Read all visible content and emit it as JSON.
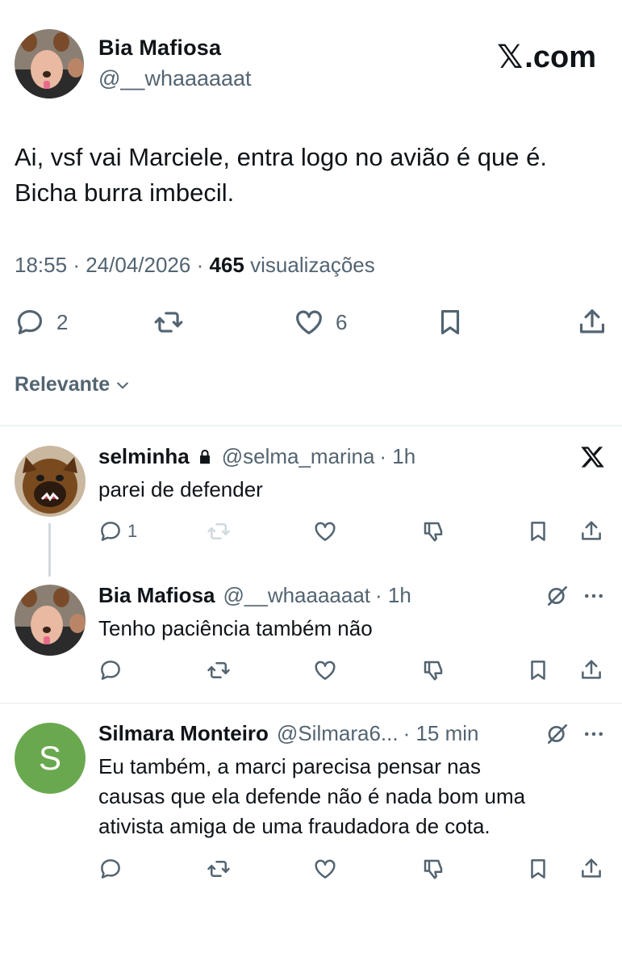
{
  "brand": {
    "label": ".com",
    "x_symbol": "𝕏"
  },
  "tweet": {
    "author_name": "Bia Mafiosa",
    "author_handle": "@__whaaaaaat",
    "text_line1": "Ai, vsf vai Marciele, entra logo no avião é que é.",
    "text_line2": "Bicha burra imbecil.",
    "time": "18:55",
    "date": "24/04/2026",
    "views_count": "465",
    "views_label": "visualizações",
    "sep": "·",
    "replies": "2",
    "likes": "6"
  },
  "sort": {
    "label": "Relevante"
  },
  "replies": [
    {
      "name": "selminha",
      "handle": "@selma_marina",
      "time": "· 1h",
      "text": "parei de defender",
      "reply_count": "1",
      "corner_icon": "x-logo-icon"
    },
    {
      "name": "Bia Mafiosa",
      "handle": "@__whaaaaaat",
      "time": "· 1h",
      "text": "Tenho paciência também não",
      "corner_icon": "grok-icon"
    },
    {
      "name": "Silmara Monteiro",
      "handle": "@Silmara6...",
      "time": "· 15 min",
      "text_line1": "Eu também, a marci parecisa pensar nas",
      "text_line2": "causas que ela defende não é nada bom uma",
      "text_line3": "ativista amiga de uma fraudadora de cota.",
      "avatar_letter": "S",
      "corner_icon": "grok-icon"
    }
  ],
  "colors": {
    "text": "#0f1419",
    "muted": "#536471",
    "divider": "#eff3f4",
    "avatar_green": "#6aa84f",
    "thread_line": "#cfd9de"
  }
}
